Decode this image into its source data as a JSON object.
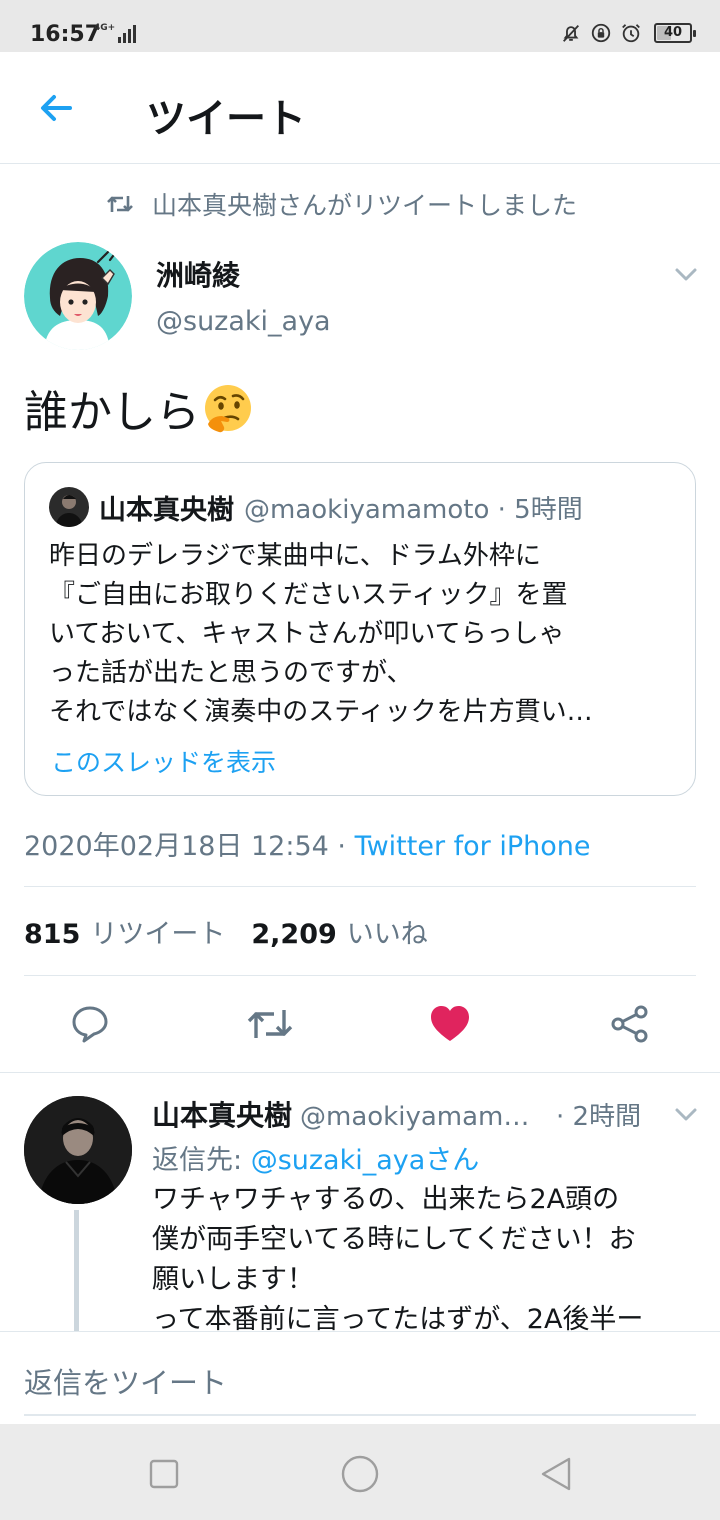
{
  "status_bar": {
    "time": "16:57",
    "network": "4G+",
    "battery": "40",
    "battery_level": 0.4
  },
  "header": {
    "title": "ツイート"
  },
  "retweet_notice": "山本真央樹さんがリツイートしました",
  "tweet": {
    "author_name": "洲崎綾",
    "author_handle": "@suzaki_aya",
    "text": "誰かしら",
    "emoji": "🤔",
    "timestamp": "2020年02月18日 12:54",
    "separator": " · ",
    "source": "Twitter for iPhone",
    "retweet_count": "815",
    "retweet_label": "リツイート",
    "like_count": "2,209",
    "like_label": "いいね"
  },
  "quote": {
    "name": "山本真央樹",
    "handle": "@maokiyamamoto · 5時間",
    "lines": [
      "昨日のデレラジで某曲中に、ドラム外枠に",
      "『ご自由にお取りくださいスティック』を置",
      "いておいて、キャストさんが叩いてらっしゃ",
      "った話が出たと思うのですが、",
      "それではなく演奏中のスティックを片方貫い…"
    ],
    "thread_link": "このスレッドを表示"
  },
  "reply": {
    "name": "山本真央樹",
    "handle": "@maokiyamam…",
    "time": "· 2時間",
    "reply_to_label": "返信先: ",
    "reply_to_handle": "@suzaki_ayaさん",
    "lines": [
      "ワチャワチャするの、出来たら2A頭の",
      "僕が両手空いてる時にしてください！お",
      "願いします！",
      "って本番前に言ってたはずが、2A後半ー"
    ]
  },
  "compose": {
    "placeholder": "返信をツイート"
  },
  "colors": {
    "accent": "#1da1f2",
    "like": "#e0245e",
    "muted": "#657786",
    "border": "#e1e8ed"
  },
  "icons": [
    "back-arrow-icon",
    "retweet-icon",
    "chevron-down-icon",
    "reply-icon",
    "like-icon",
    "share-icon",
    "square-icon",
    "circle-icon",
    "triangle-back-icon"
  ]
}
